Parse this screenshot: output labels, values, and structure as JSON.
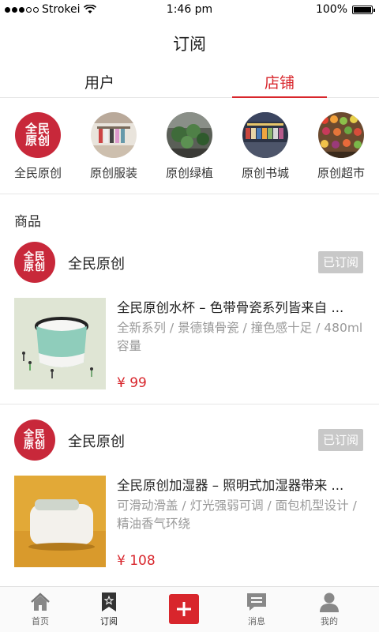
{
  "status_bar": {
    "carrier": "Strokei",
    "time": "1:46 pm",
    "battery": "100%"
  },
  "header": {
    "title": "订阅"
  },
  "tabs": [
    {
      "label": "用户",
      "active": false
    },
    {
      "label": "店铺",
      "active": true
    }
  ],
  "stores": [
    {
      "label": "全民原创",
      "logo": "全民原创"
    },
    {
      "label": "原创服装"
    },
    {
      "label": "原创绿植"
    },
    {
      "label": "原创书城"
    },
    {
      "label": "原创超市"
    }
  ],
  "section": {
    "label": "商品"
  },
  "products": [
    {
      "shop_name": "全民原创",
      "subscribe_label": "已订阅",
      "title": "全民原创水杯 – 色带骨瓷系列皆来自 ...",
      "description": "全新系列 / 景德镇骨瓷 / 撞色感十足 / 480ml 容量",
      "price": "¥ 99"
    },
    {
      "shop_name": "全民原创",
      "subscribe_label": "已订阅",
      "title": "全民原创加湿器 – 照明式加湿器带来 ...",
      "description": "可滑动滑盖 / 灯光强弱可调 / 面包机型设计 / 精油香气环绕",
      "price": "¥ 108"
    }
  ],
  "bottom_nav": [
    {
      "label": "首页",
      "icon": "home-icon"
    },
    {
      "label": "订阅",
      "icon": "bookmark-icon",
      "active": true
    },
    {
      "label": "",
      "icon": "plus-icon"
    },
    {
      "label": "消息",
      "icon": "message-icon"
    },
    {
      "label": "我的",
      "icon": "user-icon"
    }
  ],
  "colors": {
    "accent": "#d8262c",
    "brand": "#c8283a",
    "subscribed": "#c8c8c8"
  }
}
